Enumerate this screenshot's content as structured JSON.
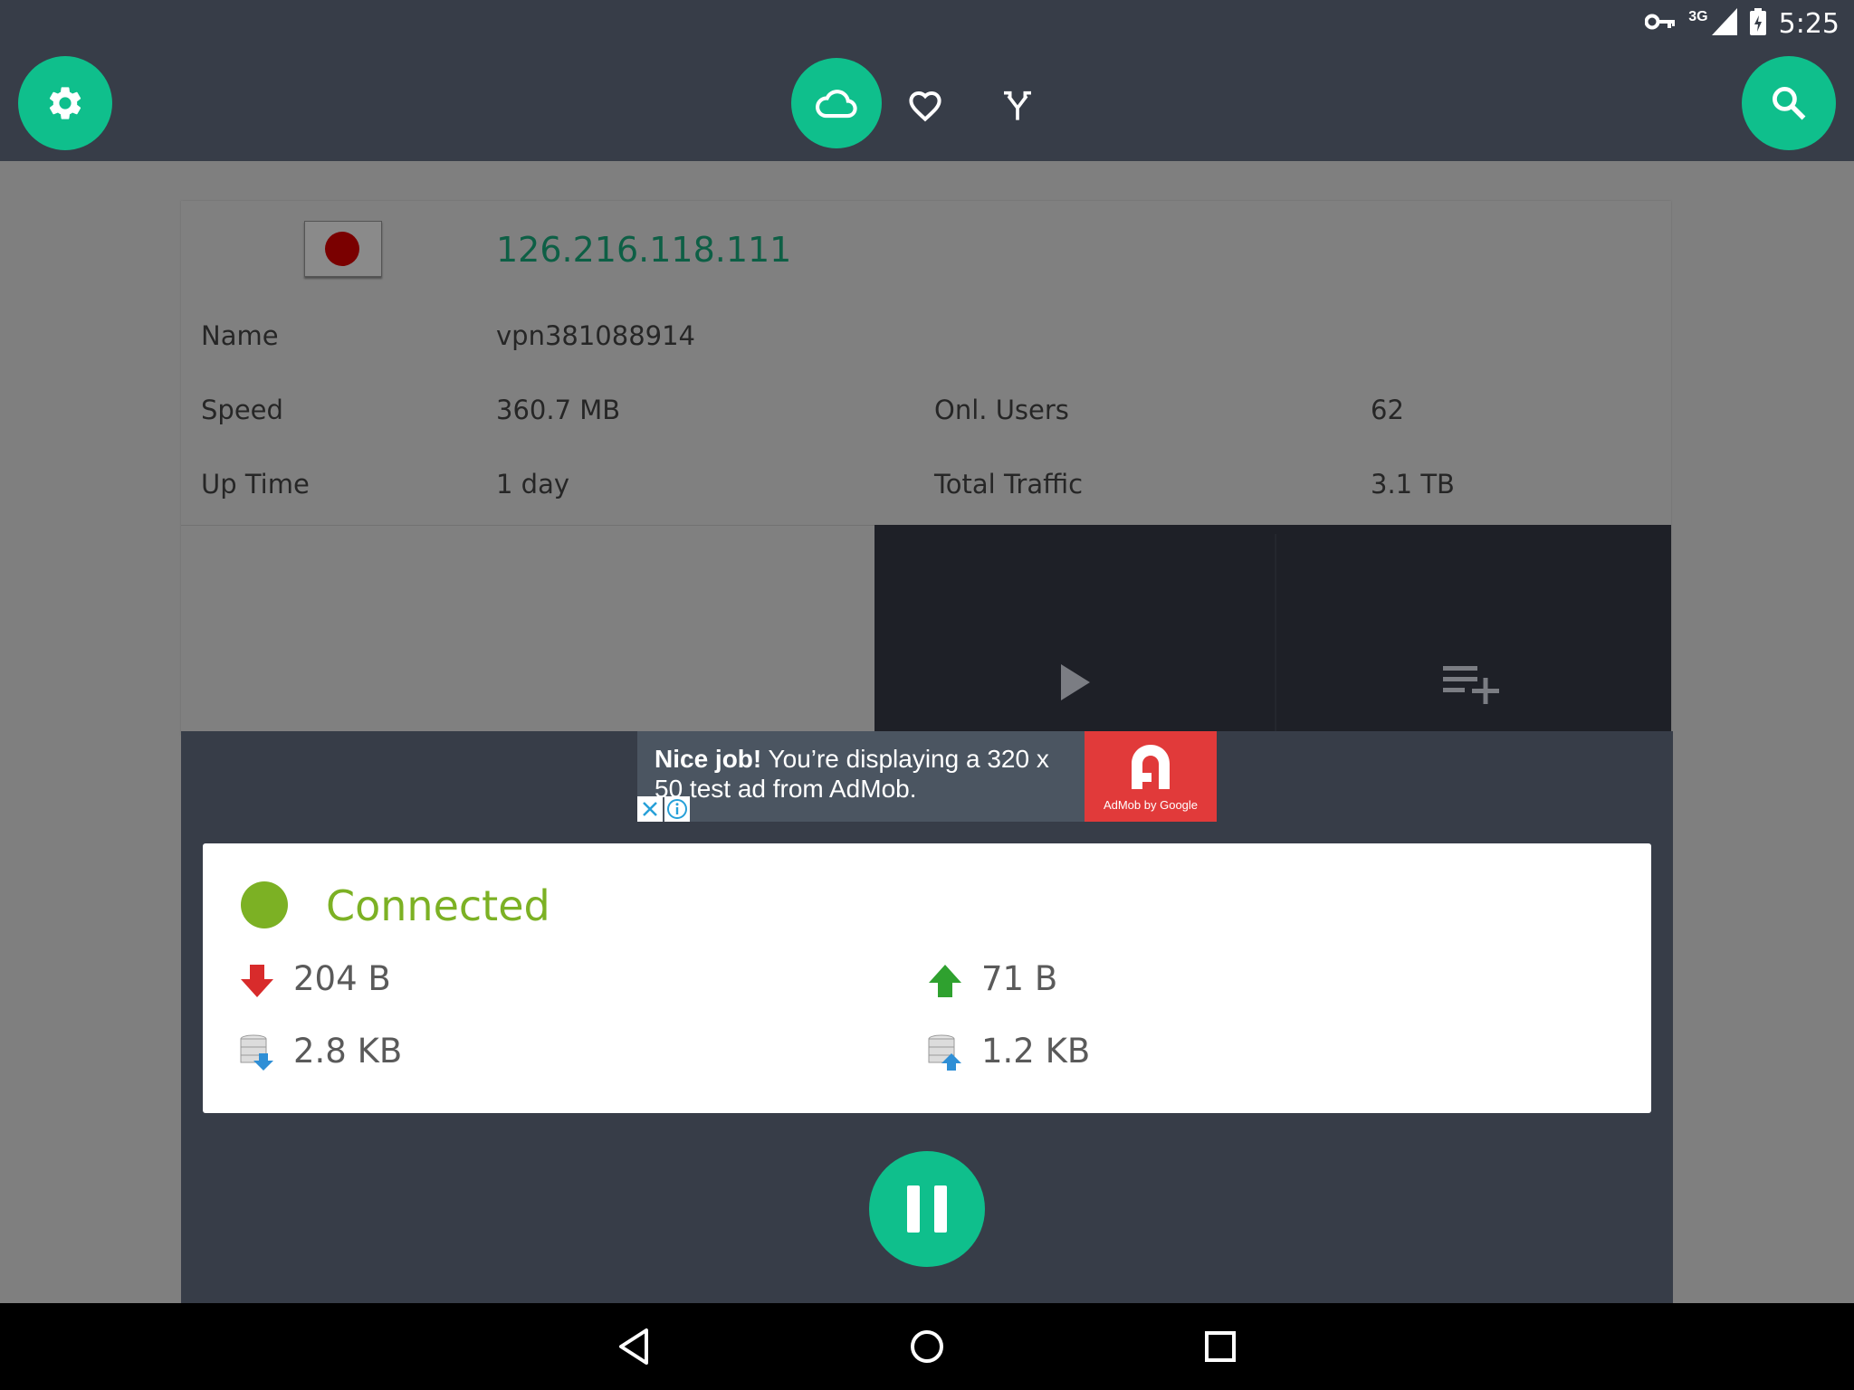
{
  "status_bar": {
    "network": "3G",
    "time": "5:25",
    "icons": [
      "vpn-key-icon",
      "signal-icon",
      "battery-icon"
    ]
  },
  "toolbar": {
    "settings_icon": "gear-icon",
    "servers_icon": "cloud-icon",
    "favorites_icon": "heart-icon",
    "split_icon": "split-arrows-icon",
    "search_icon": "search-icon",
    "accent_color": "#0fbf8c"
  },
  "server": {
    "ip": "126.216.118.111",
    "flag": "japan-flag",
    "fields": {
      "name_label": "Name",
      "name_value": "vpn381088914",
      "speed_label": "Speed",
      "speed_value": "360.7 MB",
      "online_users_label": "Onl. Users",
      "online_users_value": "62",
      "uptime_label": "Up Time",
      "uptime_value": "1 day",
      "total_traffic_label": "Total Traffic",
      "total_traffic_value": "3.1 TB"
    }
  },
  "player": {
    "play_icon": "play-icon",
    "queue_icon": "playlist-add-icon"
  },
  "ad": {
    "bold": "Nice job!",
    "text": "You’re displaying a 320 x 50 test ad from AdMob.",
    "brand": "AdMob by Google"
  },
  "connection": {
    "status": "Connected",
    "status_color": "#7cb124",
    "download_speed": "204 B",
    "upload_speed": "71 B",
    "downloaded_total": "2.8 KB",
    "uploaded_total": "1.2 KB"
  },
  "controls": {
    "pause_icon": "pause-icon"
  },
  "navigation": {
    "back_icon": "back-icon",
    "home_icon": "home-icon",
    "recents_icon": "recents-icon"
  }
}
